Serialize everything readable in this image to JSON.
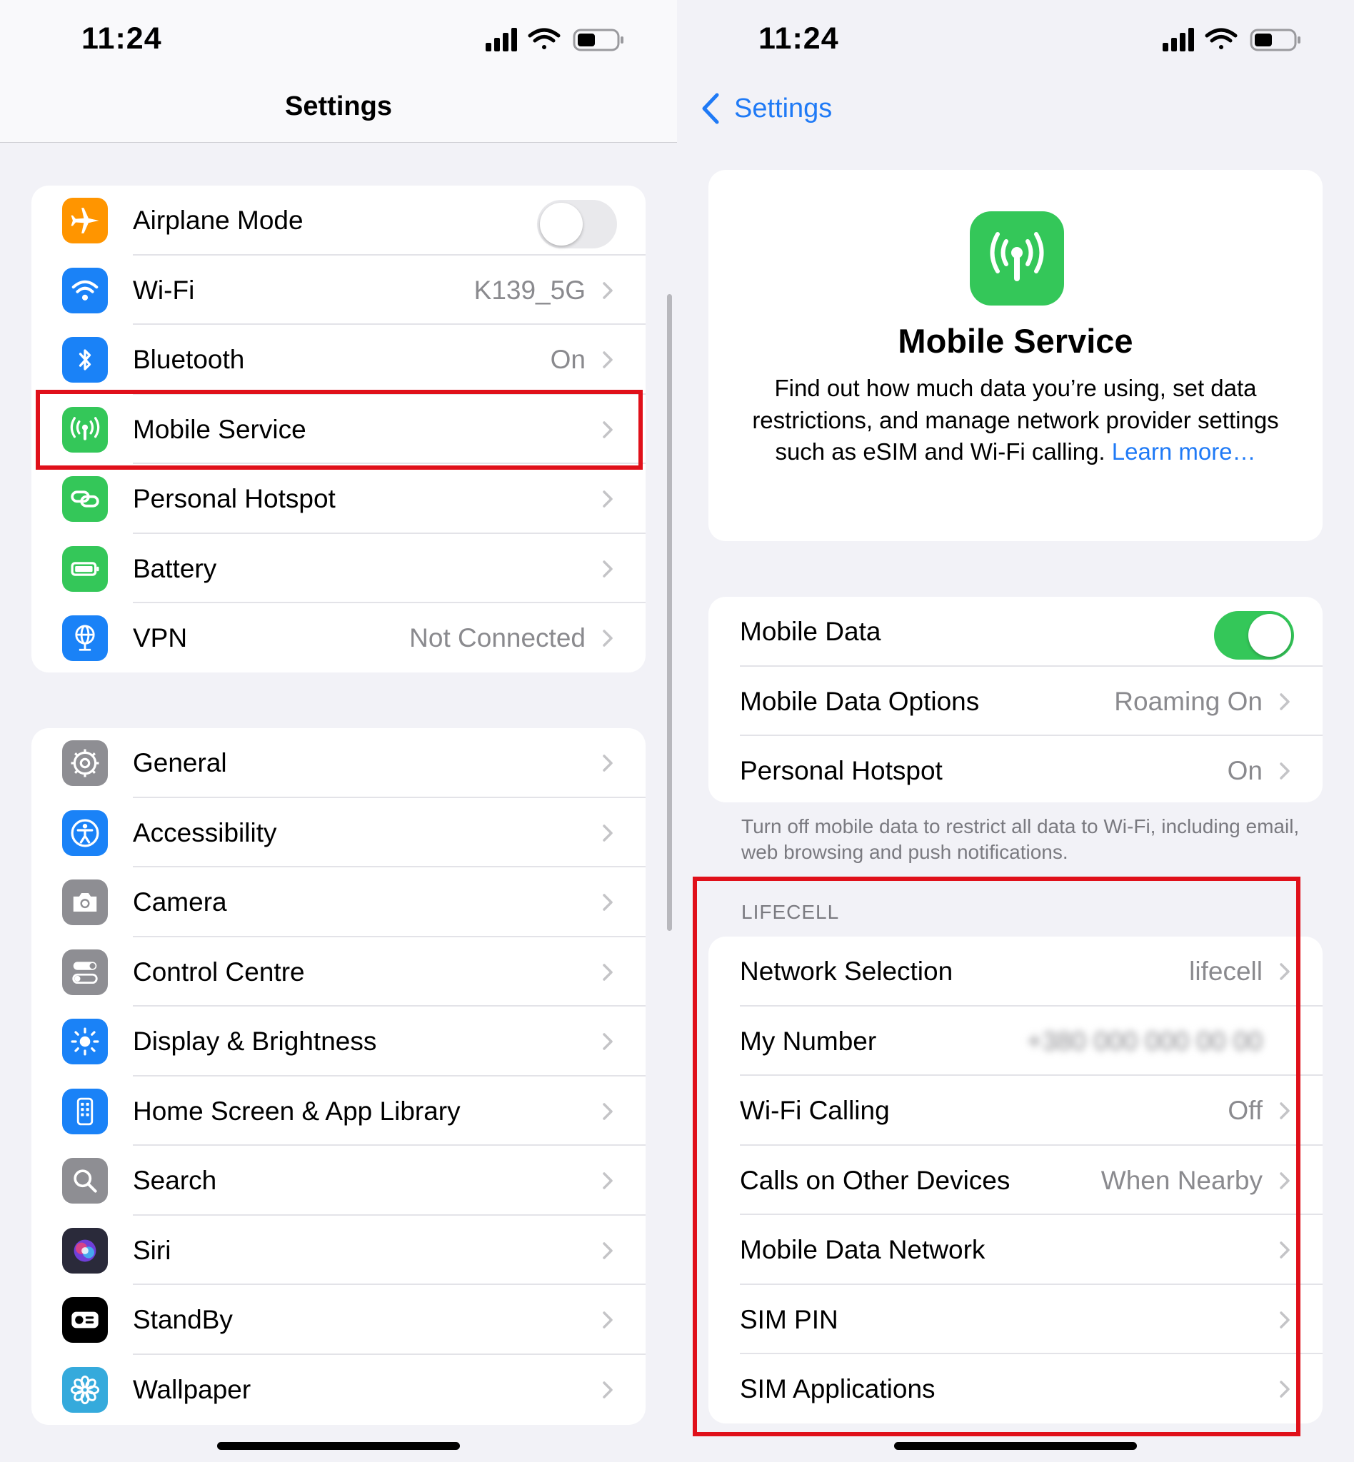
{
  "status": {
    "time": "11:24"
  },
  "left": {
    "title": "Settings",
    "group1": [
      {
        "label": "Airplane Mode",
        "value": "",
        "icon": "airplane-icon",
        "color": "#ff9500",
        "toggle": "off"
      },
      {
        "label": "Wi-Fi",
        "value": "K139_5G",
        "icon": "wifi-icon",
        "color": "#1a82f7"
      },
      {
        "label": "Bluetooth",
        "value": "On",
        "icon": "bluetooth-icon",
        "color": "#1a82f7"
      },
      {
        "label": "Mobile Service",
        "value": "",
        "icon": "antenna-icon",
        "color": "#34c759",
        "highlighted": true
      },
      {
        "label": "Personal Hotspot",
        "value": "",
        "icon": "hotspot-icon",
        "color": "#34c759"
      },
      {
        "label": "Battery",
        "value": "",
        "icon": "battery-icon",
        "color": "#34c759"
      },
      {
        "label": "VPN",
        "value": "Not Connected",
        "icon": "vpn-globe-icon",
        "color": "#1a82f7"
      }
    ],
    "group2": [
      {
        "label": "General",
        "icon": "gear-icon",
        "color": "#8e8e93"
      },
      {
        "label": "Accessibility",
        "icon": "accessibility-icon",
        "color": "#1a82f7"
      },
      {
        "label": "Camera",
        "icon": "camera-icon",
        "color": "#8e8e93"
      },
      {
        "label": "Control Centre",
        "icon": "control-centre-icon",
        "color": "#8e8e93"
      },
      {
        "label": "Display & Brightness",
        "icon": "sun-icon",
        "color": "#1a82f7"
      },
      {
        "label": "Home Screen & App Library",
        "icon": "home-screen-icon",
        "color": "#1a82f7"
      },
      {
        "label": "Search",
        "icon": "search-icon",
        "color": "#8e8e93"
      },
      {
        "label": "Siri",
        "icon": "siri-icon",
        "color": "#2a2a3a"
      },
      {
        "label": "StandBy",
        "icon": "standby-icon",
        "color": "#000000"
      },
      {
        "label": "Wallpaper",
        "icon": "wallpaper-flower-icon",
        "color": "#35aadc"
      }
    ]
  },
  "right": {
    "back_label": "Settings",
    "hero": {
      "title": "Mobile Service",
      "desc": "Find out how much data you’re using, set data restrictions, and manage network provider settings such as eSIM and Wi-Fi calling.",
      "link": "Learn more…"
    },
    "data_group": [
      {
        "label": "Mobile Data",
        "value": "",
        "toggle": "on"
      },
      {
        "label": "Mobile Data Options",
        "value": "Roaming On"
      },
      {
        "label": "Personal Hotspot",
        "value": "On"
      }
    ],
    "footnote": "Turn off mobile data to restrict all data to Wi-Fi, including email, web browsing and push notifications.",
    "carrier_header": "LIFECELL",
    "carrier_group": [
      {
        "label": "Network Selection",
        "value": "lifecell"
      },
      {
        "label": "My Number",
        "value": "+380 000 000 00 00",
        "blurred": true
      },
      {
        "label": "Wi-Fi Calling",
        "value": "Off"
      },
      {
        "label": "Calls on Other Devices",
        "value": "When Nearby"
      },
      {
        "label": "Mobile Data Network",
        "value": ""
      },
      {
        "label": "SIM PIN",
        "value": ""
      },
      {
        "label": "SIM Applications",
        "value": ""
      }
    ]
  },
  "colors": {
    "accent": "#1f7af6",
    "highlight": "#e0101a",
    "green": "#34c759"
  }
}
